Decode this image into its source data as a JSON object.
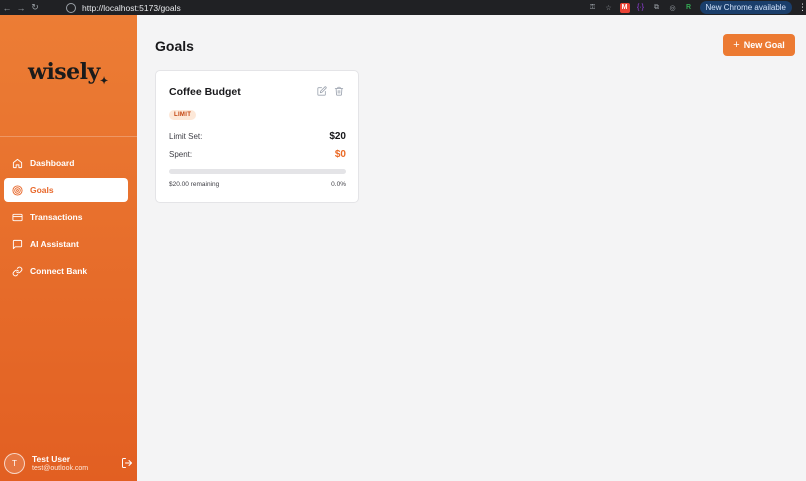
{
  "browser": {
    "url": "http://localhost:5173/goals",
    "update_label": "New Chrome available",
    "ext_m": "M",
    "ext_braces": "{·}",
    "ext_r": "R"
  },
  "sidebar": {
    "logo_text": "wisely",
    "logo_mark": "✦",
    "items": [
      {
        "label": "Dashboard",
        "icon": "home-icon"
      },
      {
        "label": "Goals",
        "icon": "target-icon",
        "active": true
      },
      {
        "label": "Transactions",
        "icon": "card-icon"
      },
      {
        "label": "AI Assistant",
        "icon": "chat-icon"
      },
      {
        "label": "Connect Bank",
        "icon": "link-icon"
      }
    ],
    "user": {
      "initial": "T",
      "name": "Test User",
      "email": "test@outlook.com"
    }
  },
  "main": {
    "title": "Goals",
    "new_goal_label": "New Goal",
    "new_goal_plus": "+"
  },
  "goal_card": {
    "title": "Coffee Budget",
    "badge": "LIMIT",
    "limit_label": "Limit Set:",
    "limit_value": "$20",
    "spent_label": "Spent:",
    "spent_value": "$0",
    "progress_fraction": 0,
    "remaining_text": "$20.00 remaining",
    "percent_text": "0.0%"
  },
  "colors": {
    "accent": "#ec7a32",
    "sidebar_top": "#ec7d35",
    "sidebar_bottom": "#e25f22",
    "spent_value": "#ea6a26",
    "badge_bg": "#fde8d8"
  }
}
